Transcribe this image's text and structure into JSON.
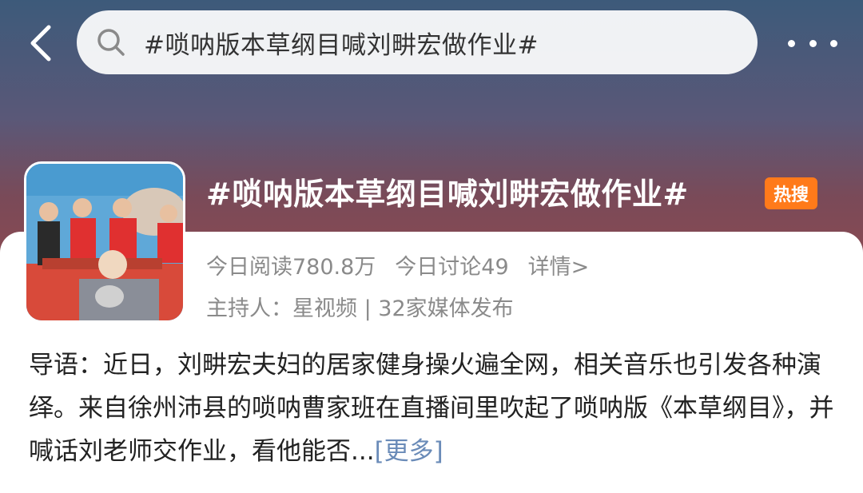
{
  "header": {
    "search_query": "#唢呐版本草纲目喊刘畊宏做作业#"
  },
  "topic": {
    "title": "#唢呐版本草纲目喊刘畊宏做作业#",
    "badge": "热搜",
    "reads": "今日阅读780.8万",
    "discussions": "今日讨论49",
    "details_link": "详情>",
    "host_label": "主持人：",
    "host_name": "星视频",
    "separator": "|",
    "media_count": "32家媒体发布"
  },
  "intro": {
    "text": "导语：近日，刘畊宏夫妇的居家健身操火遍全网，相关音乐也引发各种演绎。来自徐州沛县的唢呐曹家班在直播间里吹起了唢呐版《本草纲目》，并喊话刘老师交作业，看他能否...",
    "more_link": "[更多]"
  },
  "colors": {
    "badge": "#ff7a1a",
    "more_link": "#6a8bb8",
    "meta_text": "#8a8a8a"
  },
  "icons": [
    "back-icon",
    "search-icon",
    "more-icon"
  ]
}
